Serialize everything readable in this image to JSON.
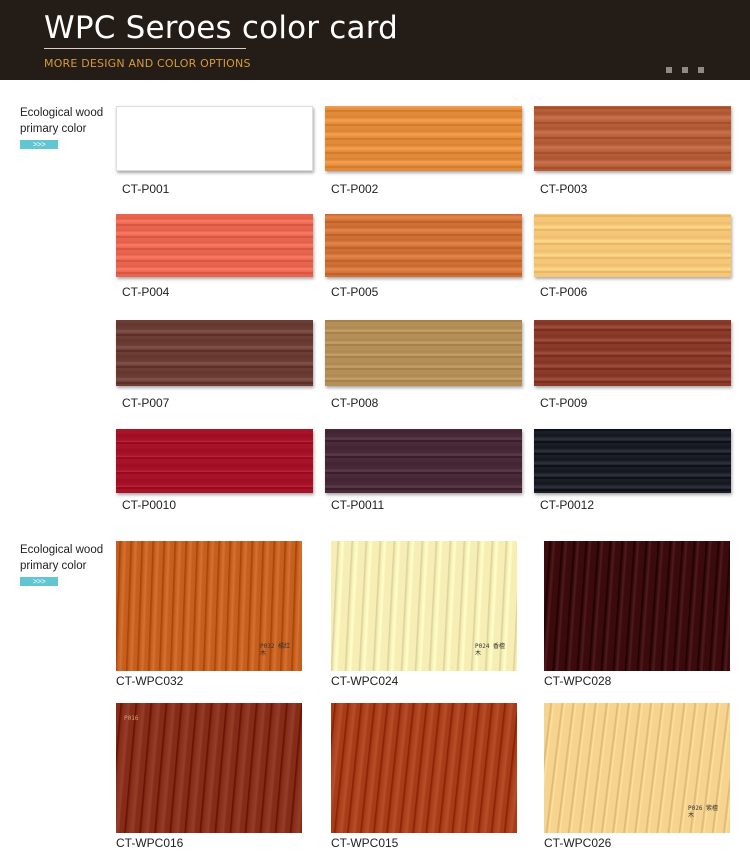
{
  "header": {
    "title": "WPC Seroes color card",
    "subtitle": "MORE DESIGN AND COLOR OPTIONS"
  },
  "sections": [
    {
      "label": "Ecological wood primary color",
      "arrow": ">>>"
    },
    {
      "label": "Ecological wood primary color",
      "arrow": ">>>"
    }
  ],
  "primary_colors": [
    {
      "code": "CT-P001",
      "color": "#ffffff"
    },
    {
      "code": "CT-P002",
      "color": "#e08a3a"
    },
    {
      "code": "CT-P003",
      "color": "#b55c38"
    },
    {
      "code": "CT-P004",
      "color": "#e7644e"
    },
    {
      "code": "CT-P005",
      "color": "#cf7036"
    },
    {
      "code": "CT-P006",
      "color": "#f4c676"
    },
    {
      "code": "CT-P007",
      "color": "#6b3d35"
    },
    {
      "code": "CT-P008",
      "color": "#b58f58"
    },
    {
      "code": "CT-P009",
      "color": "#8a3b2a"
    },
    {
      "code": "CT-P0010",
      "color": "#a7142a"
    },
    {
      "code": "CT-P0011",
      "color": "#4a2b3a"
    },
    {
      "code": "CT-P0012",
      "color": "#1b1e26"
    }
  ],
  "wpc_colors": [
    {
      "code": "CT-WPC032",
      "color": "#c45f1f",
      "stamp": "P032 橘红木"
    },
    {
      "code": "CT-WPC024",
      "color": "#f7eeb6",
      "stamp": "P024 香檀木"
    },
    {
      "code": "CT-WPC028",
      "color": "#3a0a0c",
      "stamp": ""
    },
    {
      "code": "CT-WPC016",
      "color": "#842c17",
      "stamp": "P016"
    },
    {
      "code": "CT-WPC015",
      "color": "#a63c18",
      "stamp": ""
    },
    {
      "code": "CT-WPC026",
      "color": "#f6d490",
      "stamp": "P026 紫檀木"
    }
  ]
}
